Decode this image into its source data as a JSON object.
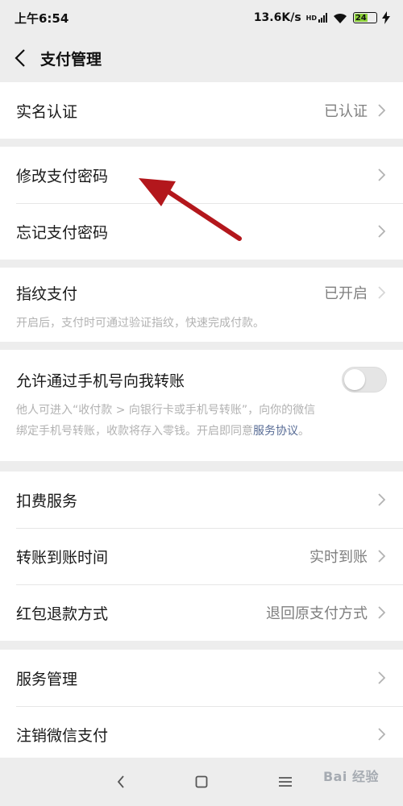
{
  "status_bar": {
    "time": "上午6:54",
    "network_speed": "13.6K/s",
    "network_type": "HD",
    "battery": "24"
  },
  "header": {
    "title": "支付管理"
  },
  "sections": {
    "identity": {
      "label": "实名认证",
      "value": "已认证"
    },
    "password": {
      "change_label": "修改支付密码",
      "forgot_label": "忘记支付密码"
    },
    "fingerprint": {
      "label": "指纹支付",
      "value": "已开启",
      "description": "开启后，支付时可通过验证指纹，快速完成付款。"
    },
    "phone_transfer": {
      "label": "允许通过手机号向我转账",
      "enabled": false,
      "description_line1": "他人可进入“收付款 > 向银行卡或手机号转账”，向你的微信",
      "description_line2": "绑定手机号转账，收款将存入零钱。开启即同意",
      "description_link": "服务协议",
      "description_end": "。"
    },
    "services": {
      "deduction_label": "扣费服务",
      "arrival_label": "转账到账时间",
      "arrival_value": "实时到账",
      "refund_label": "红包退款方式",
      "refund_value": "退回原支付方式"
    },
    "manage": {
      "service_manage_label": "服务管理",
      "cancel_label": "注销微信支付"
    }
  },
  "watermark": "Bai 经验",
  "colors": {
    "background": "#ededed",
    "link": "#576b95",
    "annotation_arrow": "#b3171c"
  }
}
